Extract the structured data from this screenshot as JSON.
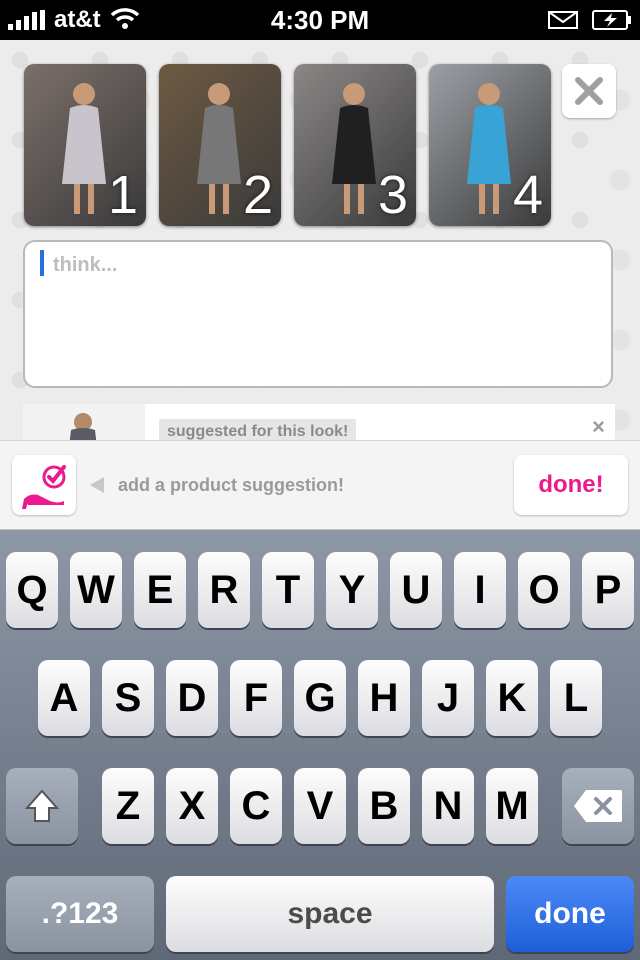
{
  "status_bar": {
    "carrier": "at&t",
    "time": "4:30 PM"
  },
  "photos": [
    {
      "label": "1",
      "bg": "#7b6f6a",
      "figure": "#c9c3cc"
    },
    {
      "label": "2",
      "bg": "#6e5a43",
      "figure": "#777"
    },
    {
      "label": "3",
      "bg": "#8b8787",
      "figure": "#202020"
    },
    {
      "label": "4",
      "bg": "#9ca0a6",
      "figure": "#3aa3d6"
    }
  ],
  "compose": {
    "placeholder": "think..."
  },
  "suggestion_card": {
    "label": "suggested for this look!",
    "close": "×"
  },
  "accessory_bar": {
    "hint": "add a product suggestion!",
    "done_label": "done!"
  },
  "keyboard": {
    "row1": [
      "Q",
      "W",
      "E",
      "R",
      "T",
      "Y",
      "U",
      "I",
      "O",
      "P"
    ],
    "row2": [
      "A",
      "S",
      "D",
      "F",
      "G",
      "H",
      "J",
      "K",
      "L"
    ],
    "row3": [
      "Z",
      "X",
      "C",
      "V",
      "B",
      "N",
      "M"
    ],
    "numbers_label": ".?123",
    "space_label": "space",
    "done_label": "done"
  },
  "colors": {
    "accent_pink": "#ec1a8c",
    "done_blue": "#1f5ed9",
    "keyboard_bg": "#6d7584"
  }
}
